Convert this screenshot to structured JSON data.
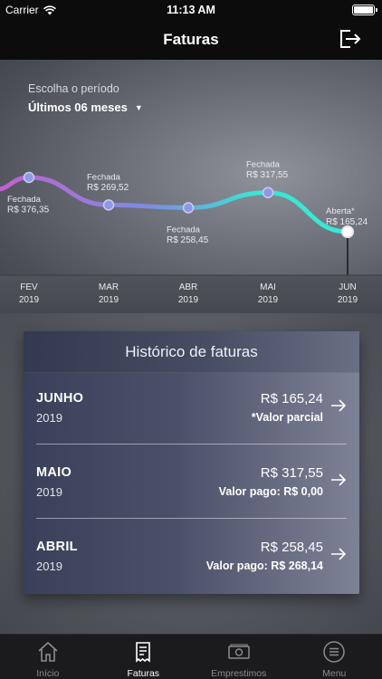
{
  "status_bar": {
    "carrier": "Carrier",
    "time": "11:13 AM"
  },
  "navbar": {
    "title": "Faturas",
    "logout_icon": "logout-icon"
  },
  "period": {
    "label": "Escolha o período",
    "selected": "Últimos 06 meses"
  },
  "colors": {
    "line_start": "#c45fd0",
    "line_mid": "#7a8ee0",
    "line_end": "#37e8d6",
    "point_fill": "#8f98e6",
    "point_stroke": "#c9ccf0"
  },
  "chart_data": {
    "type": "line",
    "series": [
      {
        "values": [
          376.35,
          269.52,
          258.45,
          317.55,
          165.24
        ]
      }
    ],
    "categories": [
      "FEV",
      "MAR",
      "ABR",
      "MAI",
      "JUN"
    ],
    "category_years": [
      "2019",
      "2019",
      "2019",
      "2019",
      "2019"
    ],
    "point_status": [
      "Fechada",
      "Fechada",
      "Fechada",
      "Fechada",
      "Aberta*"
    ],
    "point_labels": [
      "R$  376,35",
      "R$  269,52",
      "R$  258,45",
      "R$  317,55",
      "R$  165,24"
    ]
  },
  "history": {
    "title": "Histórico de faturas",
    "items": [
      {
        "month": "JUNHO",
        "year": "2019",
        "amount": "R$  165,24",
        "note": "*Valor parcial"
      },
      {
        "month": "MAIO",
        "year": "2019",
        "amount": "R$  317,55",
        "note": "Valor pago: R$ 0,00"
      },
      {
        "month": "ABRIL",
        "year": "2019",
        "amount": "R$  258,45",
        "note": "Valor pago:  R$  268,14"
      }
    ]
  },
  "tabs": [
    {
      "label": "Início",
      "icon": "home-icon",
      "active": false
    },
    {
      "label": "Faturas",
      "icon": "invoice-icon",
      "active": true
    },
    {
      "label": "Emprestimos",
      "icon": "money-icon",
      "active": false
    },
    {
      "label": "Menu",
      "icon": "menu-icon",
      "active": false
    }
  ]
}
